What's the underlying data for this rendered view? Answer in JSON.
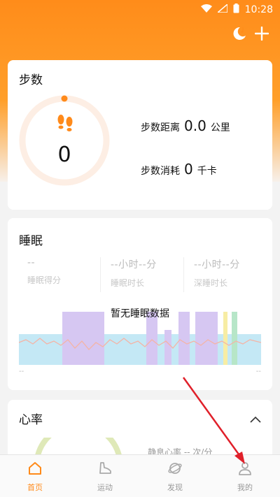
{
  "status_bar": {
    "time": "10:28"
  },
  "steps_card": {
    "title": "步数",
    "steps": "0",
    "distance_label": "步数距离",
    "distance_value": "0.0",
    "distance_unit": "公里",
    "calorie_label": "步数消耗",
    "calorie_value": "0",
    "calorie_unit": "千卡"
  },
  "sleep_card": {
    "title": "睡眠",
    "stats": [
      {
        "value": "--",
        "label": "睡眠得分"
      },
      {
        "value": "--小时--分",
        "label": "睡眠时长"
      },
      {
        "value": "--小时--分",
        "label": "深睡时长"
      }
    ],
    "no_data": "暂无睡眠数据",
    "axis_left": "--",
    "axis_right": "--"
  },
  "heart_card": {
    "title": "心率",
    "resting": "静息心率 -- 次/分"
  },
  "bottom_nav": {
    "items": [
      {
        "label": "首页",
        "active": true,
        "icon": "home-icon"
      },
      {
        "label": "运动",
        "active": false,
        "icon": "shoe-icon"
      },
      {
        "label": "发现",
        "active": false,
        "icon": "planet-icon"
      },
      {
        "label": "我的",
        "active": false,
        "icon": "user-icon"
      }
    ]
  },
  "colors": {
    "accent": "#ff8a1a",
    "sleep_light": "#c4e8f5",
    "sleep_deep": "#d6c7f2",
    "sleep_rem": "#f7eda4",
    "sleep_awake": "#b7e6c8",
    "annotation_arrow": "#e0202a"
  }
}
